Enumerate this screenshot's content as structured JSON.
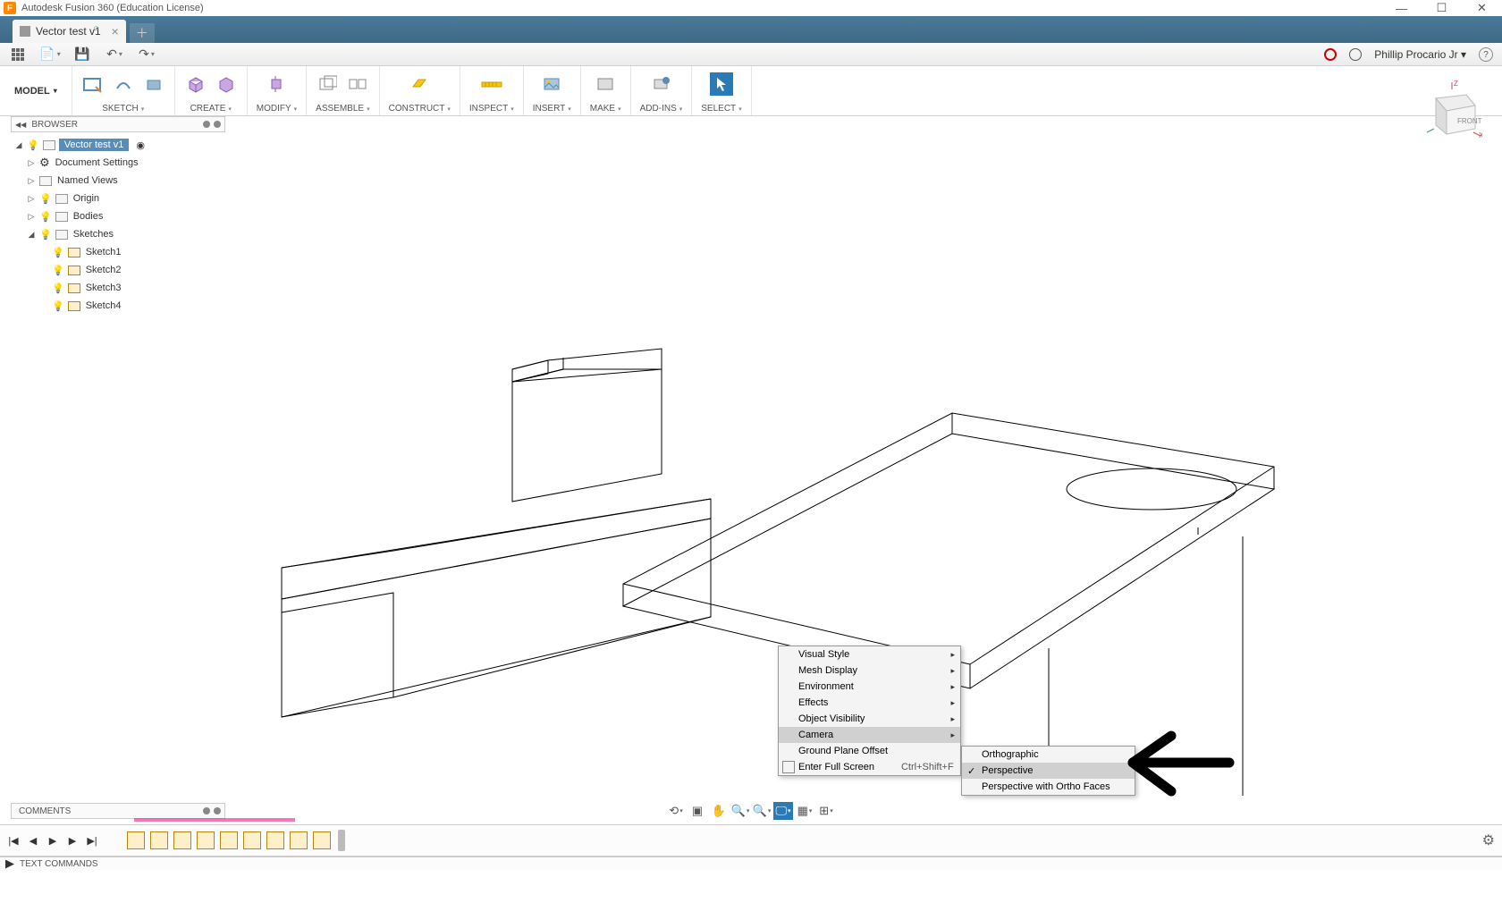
{
  "app_title": "Autodesk Fusion 360 (Education License)",
  "tab": {
    "name": "Vector test v1"
  },
  "workspace": "MODEL",
  "ribbon": {
    "sketch": "SKETCH",
    "create": "CREATE",
    "modify": "MODIFY",
    "assemble": "ASSEMBLE",
    "construct": "CONSTRUCT",
    "inspect": "INSPECT",
    "insert": "INSERT",
    "make": "MAKE",
    "addins": "ADD-INS",
    "select": "SELECT"
  },
  "user": "Phillip Procario Jr",
  "browser": {
    "title": "BROWSER",
    "root": "Vector test v1",
    "doc_settings": "Document Settings",
    "named_views": "Named Views",
    "origin": "Origin",
    "bodies": "Bodies",
    "sketches": "Sketches",
    "sketch_items": [
      "Sketch1",
      "Sketch2",
      "Sketch3",
      "Sketch4"
    ]
  },
  "viewcube": {
    "front": "FRONT",
    "x": "X",
    "y": "Y",
    "z": "Z"
  },
  "context_menu": {
    "visual_style": "Visual Style",
    "mesh_display": "Mesh Display",
    "environment": "Environment",
    "effects": "Effects",
    "object_visibility": "Object Visibility",
    "camera": "Camera",
    "ground_plane_offset": "Ground Plane Offset",
    "enter_full_screen": "Enter Full Screen",
    "full_screen_shortcut": "Ctrl+Shift+F"
  },
  "camera_submenu": {
    "orthographic": "Orthographic",
    "perspective": "Perspective",
    "perspective_ortho": "Perspective with Ortho Faces"
  },
  "comments": "COMMENTS",
  "text_commands": "TEXT COMMANDS"
}
